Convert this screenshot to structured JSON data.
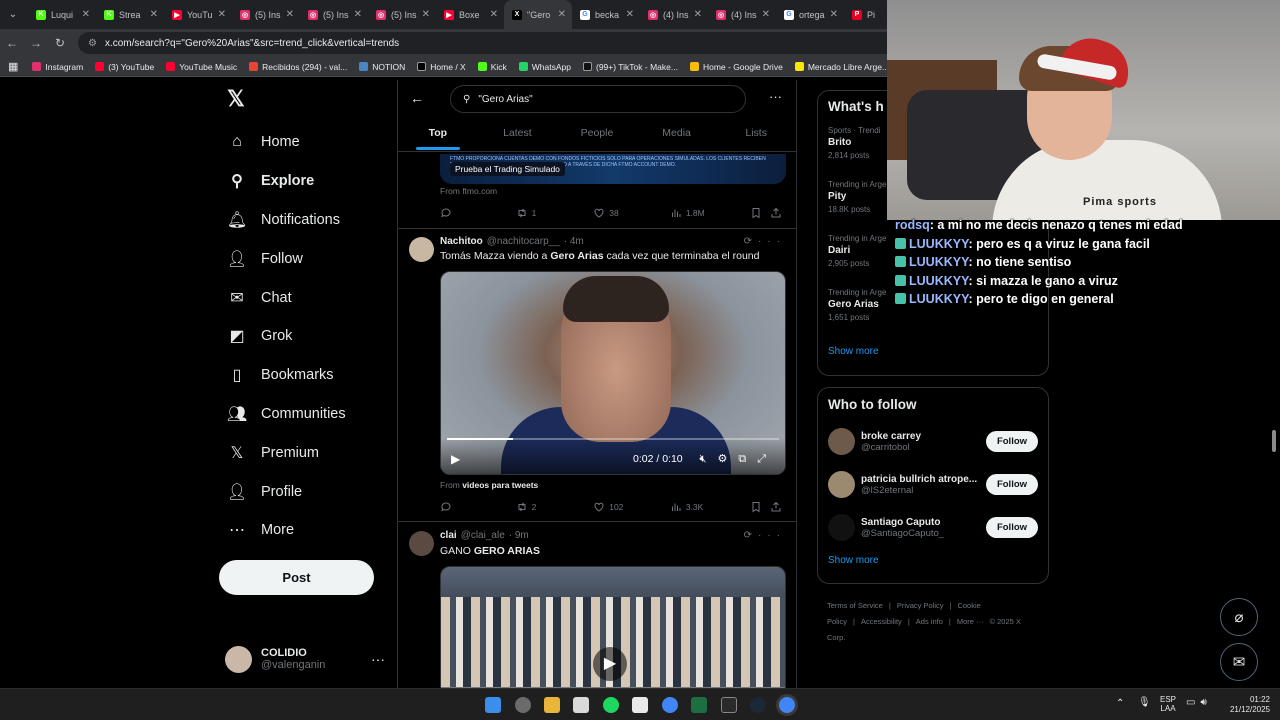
{
  "browser": {
    "tabs": [
      {
        "title": "Luqui",
        "color": "#53fc18",
        "glyph": "K"
      },
      {
        "title": "Strea",
        "color": "#53fc18",
        "glyph": "K"
      },
      {
        "title": "YouTu",
        "color": "#ff0033",
        "glyph": "▶"
      },
      {
        "title": "(5) Ins",
        "color": "#e1306c",
        "glyph": "◎"
      },
      {
        "title": "(5) Ins",
        "color": "#e1306c",
        "glyph": "◎"
      },
      {
        "title": "(5) Ins",
        "color": "#e1306c",
        "glyph": "◎"
      },
      {
        "title": "Boxe",
        "color": "#ff0033",
        "glyph": "▶"
      },
      {
        "title": "\"Gero",
        "color": "#000000",
        "glyph": "X",
        "active": true
      },
      {
        "title": "becka",
        "color": "#ffffff",
        "glyph": "G"
      },
      {
        "title": "(4) Ins",
        "color": "#e1306c",
        "glyph": "◎"
      },
      {
        "title": "(4) Ins",
        "color": "#e1306c",
        "glyph": "◎"
      },
      {
        "title": "ortega",
        "color": "#ffffff",
        "glyph": "G"
      },
      {
        "title": "Pi",
        "color": "#e60023",
        "glyph": "P"
      }
    ],
    "url": "x.com/search?q=\"Gero%20Arias\"&src=trend_click&vertical=trends",
    "bookmarks": [
      {
        "label": "Instagram",
        "color": "#e1306c"
      },
      {
        "label": "(3) YouTube",
        "color": "#ff0033"
      },
      {
        "label": "YouTube Music",
        "color": "#ff0033"
      },
      {
        "label": "Recibidos (294) - val...",
        "color": "#ea4335"
      },
      {
        "label": "NOTION",
        "color": "#4a86c5"
      },
      {
        "label": "Home / X",
        "color": "#000000"
      },
      {
        "label": "Kick",
        "color": "#53fc18"
      },
      {
        "label": "WhatsApp",
        "color": "#25d366"
      },
      {
        "label": "(99+) TikTok - Make...",
        "color": "#111111"
      },
      {
        "label": "Home - Google Drive",
        "color": "#fbbc04"
      },
      {
        "label": "Mercado Libre Arge...",
        "color": "#ffe600"
      }
    ]
  },
  "nav": {
    "logo": "𝕏",
    "items": [
      {
        "label": "Home",
        "icon": "home-icon",
        "glyph": "⌂"
      },
      {
        "label": "Explore",
        "icon": "search-icon",
        "glyph": "⚲",
        "bold": true
      },
      {
        "label": "Notifications",
        "icon": "bell-icon",
        "glyph": "🔔︎"
      },
      {
        "label": "Follow",
        "icon": "add-person-icon",
        "glyph": "👤︎"
      },
      {
        "label": "Chat",
        "icon": "mail-icon",
        "glyph": "✉"
      },
      {
        "label": "Grok",
        "icon": "grok-icon",
        "glyph": "◩"
      },
      {
        "label": "Bookmarks",
        "icon": "bookmark-icon",
        "glyph": "▯"
      },
      {
        "label": "Communities",
        "icon": "communities-icon",
        "glyph": "👥︎"
      },
      {
        "label": "Premium",
        "icon": "x-icon",
        "glyph": "𝕏"
      },
      {
        "label": "Profile",
        "icon": "profile-icon",
        "glyph": "👤︎"
      },
      {
        "label": "More",
        "icon": "more-circle-icon",
        "glyph": "⋯"
      }
    ],
    "post_label": "Post",
    "account": {
      "name": "COLIDIO",
      "handle": "@valenganin"
    }
  },
  "search": {
    "query": "\"Gero Arias\"",
    "tabs": [
      "Top",
      "Latest",
      "People",
      "Media",
      "Lists"
    ],
    "active_tab": "Top"
  },
  "ad": {
    "fine_print": "FTMO PROPORCIONA CUENTAS DEMO CON FONDOS FICTICIOS SOLO PARA OPERACIONES SIMULADAS. LOS CLIENTES RECIBEN RECOMPENSAS BASADAS EN SU RENDIMIENTO A TRAVÉS DE DICHA FTMO ACCOUNT DEMO.",
    "cta": "Prueba el Trading Simulado",
    "from": "From ftmo.com",
    "replies": "",
    "reposts": "1",
    "likes": "38",
    "views": "1.8M"
  },
  "tweets": [
    {
      "name": "Nachitoo",
      "handle": "@nachitocarp__",
      "time": "· 4m",
      "text_pre": "Tomás Mazza viendo a ",
      "text_bold": "Gero Arias",
      "text_post": " cada vez que terminaba el round",
      "video_time": "0:02 / 0:10",
      "from_prefix": "From ",
      "from_bold": "videos para tweets",
      "replies": "",
      "reposts": "2",
      "likes": "102",
      "views": "3.3K"
    },
    {
      "name": "clai",
      "handle": "@clai_ale",
      "time": "· 9m",
      "text_pre": "GANO ",
      "text_bold": "GERO ARIAS",
      "text_post": ""
    }
  ],
  "right": {
    "trends_title": "What's h",
    "trends": [
      {
        "category": "Sports · Trendi",
        "name": "Brito",
        "posts": "2,814 posts"
      },
      {
        "category": "Trending in Arge",
        "name": "Pity",
        "posts": "18.8K posts"
      },
      {
        "category": "Trending in Arge",
        "name": "Dairi",
        "posts": "2,905 posts"
      },
      {
        "category": "Trending in Arge",
        "name": "Gero Arias",
        "posts": "1,651 posts"
      }
    ],
    "show_more": "Show more",
    "wtf_title": "Who to follow",
    "follow": [
      {
        "name": "broke carrey",
        "handle": "@carritobol",
        "color": "#6d5a4a"
      },
      {
        "name": "patricia bullrich atrope...",
        "handle": "@lS2eternal",
        "color": "#9c8a70"
      },
      {
        "name": "Santiago Caputo",
        "handle": "@SantiagoCaputo_",
        "color": "#111111"
      }
    ],
    "follow_label": "Follow",
    "footer": [
      "Terms of Service",
      "|",
      "Privacy Policy",
      "|",
      "Cookie Policy",
      "|",
      "Accessibility",
      "|",
      "Ads info",
      "|",
      "More ···",
      "© 2025 X Corp."
    ]
  },
  "stream": {
    "shirt_text": "Pima sports",
    "chat": [
      {
        "user": "rodsq",
        "msg": "a mi no me decis nenazo q tenes mi edad",
        "badge": false
      },
      {
        "user": "LUUKKYY",
        "msg": "pero es q a viruz le gana facil",
        "badge": true
      },
      {
        "user": "LUUKKYY",
        "msg": "no tiene sentiso",
        "badge": true
      },
      {
        "user": "LUUKKYY",
        "msg": "si mazza le gano a viruz",
        "badge": true
      },
      {
        "user": "LUUKKYY",
        "msg": "pero te digo en general",
        "badge": true
      }
    ]
  },
  "taskbar": {
    "lang": "ESP",
    "layout": "LAA",
    "time": "01:22",
    "date": "21/12/2025"
  }
}
